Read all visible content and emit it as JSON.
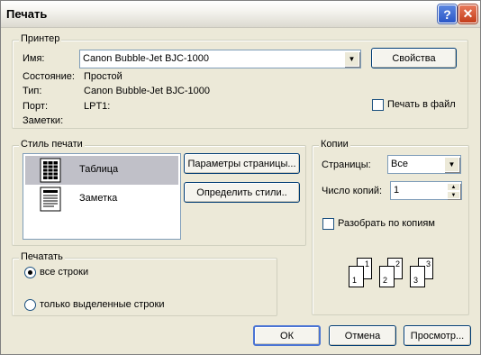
{
  "window": {
    "title": "Печать",
    "help_glyph": "?",
    "close_glyph": "✕"
  },
  "printer": {
    "legend": "Принтер",
    "name_label": "Имя:",
    "name_value": "Canon Bubble-Jet BJC-1000",
    "properties_button": "Свойства",
    "status_label": "Состояние:",
    "status_value": "Простой",
    "type_label": "Тип:",
    "type_value": "Canon Bubble-Jet BJC-1000",
    "port_label": "Порт:",
    "port_value": "LPT1:",
    "notes_label": "Заметки:",
    "print_to_file_label": "Печать в файл",
    "print_to_file_checked": false
  },
  "print_style": {
    "legend": "Стиль печати",
    "items": [
      {
        "label": "Таблица",
        "icon": "table-style-icon",
        "selected": true
      },
      {
        "label": "Заметка",
        "icon": "memo-style-icon",
        "selected": false
      }
    ],
    "page_setup_button": "Параметры страницы...",
    "define_styles_button": "Определить стили.."
  },
  "copies": {
    "legend": "Копии",
    "pages_label": "Страницы:",
    "pages_value": "Все",
    "count_label": "Число копий:",
    "count_value": "1",
    "collate_label": "Разобрать по копиям",
    "collate_checked": false,
    "collate_sets": [
      [
        "1",
        "1"
      ],
      [
        "2",
        "2"
      ],
      [
        "3",
        "3"
      ]
    ]
  },
  "print_range": {
    "legend": "Печатать",
    "options": [
      {
        "label": "все строки",
        "checked": true
      },
      {
        "label": "только выделенные строки",
        "checked": false
      }
    ]
  },
  "buttons": {
    "ok": "ОК",
    "cancel": "Отмена",
    "preview": "Просмотр..."
  }
}
